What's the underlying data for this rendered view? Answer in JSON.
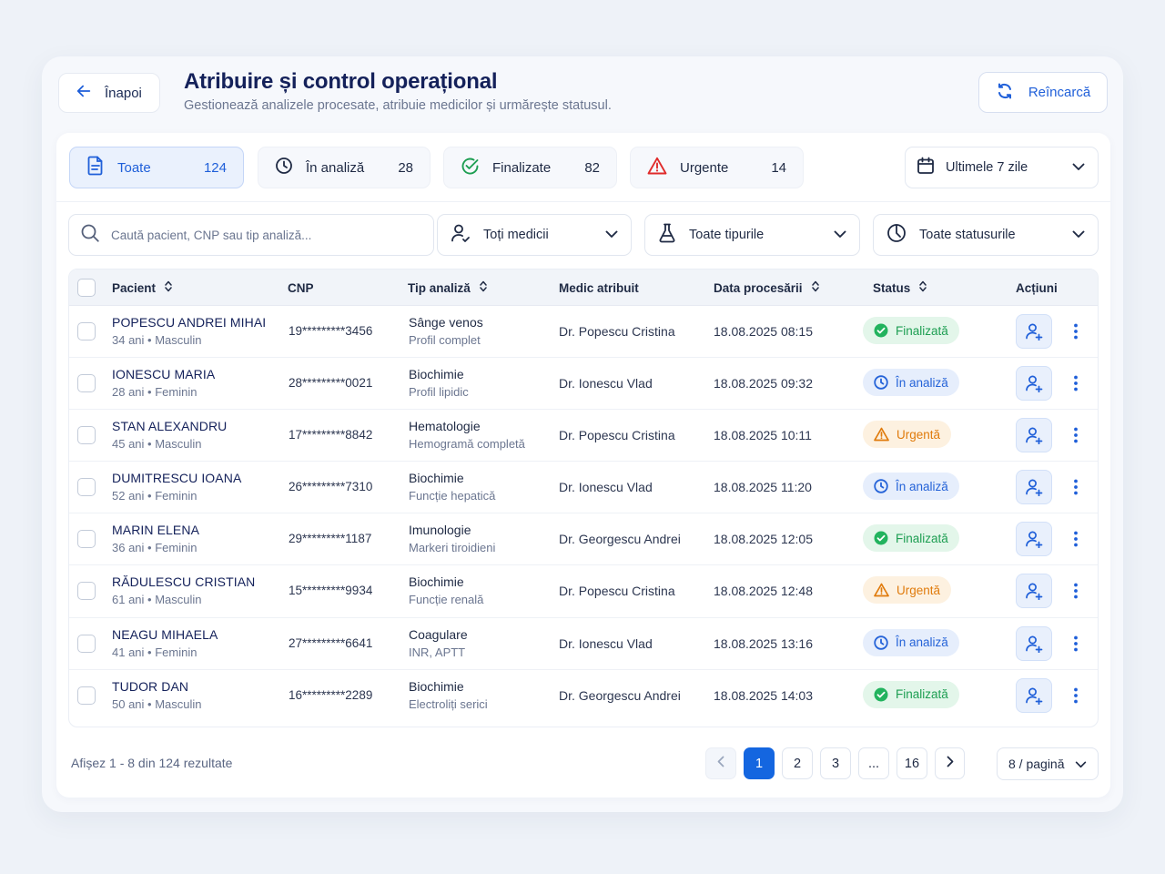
{
  "header": {
    "back_label": "Înapoi",
    "title": "Atribuire și control operațional",
    "subtitle": "Gestionează analizele procesate, atribuie medicilor și urmărește statusul.",
    "reload_label": "Reîncarcă"
  },
  "tabs": [
    {
      "label": "Toate",
      "count": "124",
      "icon": "document-icon",
      "active": true
    },
    {
      "label": "În analiză",
      "count": "28",
      "icon": "clock-icon",
      "active": false
    },
    {
      "label": "Finalizate",
      "count": "82",
      "icon": "check-circle-icon",
      "active": false
    },
    {
      "label": "Urgente",
      "count": "14",
      "icon": "warning-icon",
      "active": false
    }
  ],
  "date_filter": {
    "value": "Ultimele 7 zile",
    "icon": "calendar-icon"
  },
  "search": {
    "placeholder": "Caută pacient, CNP sau tip analiză..."
  },
  "filters": {
    "doctors": "Toți medicii",
    "types": "Toate tipurile",
    "statuses": "Toate statusurile"
  },
  "table": {
    "columns": {
      "patient": "Pacient",
      "cnp": "CNP",
      "type": "Tip analiză",
      "doctor": "Medic atribuit",
      "date": "Data procesării",
      "status": "Status",
      "actions": "Acțiuni"
    },
    "rows": [
      {
        "name": "POPESCU ANDREI MIHAI",
        "info": "34 ani • Masculin",
        "cnp": "19*********3456",
        "type": "Sânge venos",
        "subtype": "Profil complet",
        "doctor": "Dr. Popescu Cristina",
        "date": "18.08.2025 08:15",
        "status": "Finalizată",
        "status_kind": "green"
      },
      {
        "name": "IONESCU MARIA",
        "info": "28 ani • Feminin",
        "cnp": "28*********0021",
        "type": "Biochimie",
        "subtype": "Profil lipidic",
        "doctor": "Dr. Ionescu Vlad",
        "date": "18.08.2025 09:32",
        "status": "În analiză",
        "status_kind": "blue"
      },
      {
        "name": "STAN ALEXANDRU",
        "info": "45 ani • Masculin",
        "cnp": "17*********8842",
        "type": "Hematologie",
        "subtype": "Hemogramă completă",
        "doctor": "Dr. Popescu Cristina",
        "date": "18.08.2025 10:11",
        "status": "Urgentă",
        "status_kind": "orange"
      },
      {
        "name": "DUMITRESCU IOANA",
        "info": "52 ani • Feminin",
        "cnp": "26*********7310",
        "type": "Biochimie",
        "subtype": "Funcție hepatică",
        "doctor": "Dr. Ionescu Vlad",
        "date": "18.08.2025 11:20",
        "status": "În analiză",
        "status_kind": "blue"
      },
      {
        "name": "MARIN ELENA",
        "info": "36 ani • Feminin",
        "cnp": "29*********1187",
        "type": "Imunologie",
        "subtype": "Markeri tiroidieni",
        "doctor": "Dr. Georgescu Andrei",
        "date": "18.08.2025 12:05",
        "status": "Finalizată",
        "status_kind": "green"
      },
      {
        "name": "RĂDULESCU CRISTIAN",
        "info": "61 ani • Masculin",
        "cnp": "15*********9934",
        "type": "Biochimie",
        "subtype": "Funcție renală",
        "doctor": "Dr. Popescu Cristina",
        "date": "18.08.2025 12:48",
        "status": "Urgentă",
        "status_kind": "orange"
      },
      {
        "name": "NEAGU MIHAELA",
        "info": "41 ani • Feminin",
        "cnp": "27*********6641",
        "type": "Coagulare",
        "subtype": "INR, APTT",
        "doctor": "Dr. Ionescu Vlad",
        "date": "18.08.2025 13:16",
        "status": "În analiză",
        "status_kind": "blue"
      },
      {
        "name": "TUDOR DAN",
        "info": "50 ani • Masculin",
        "cnp": "16*********2289",
        "type": "Biochimie",
        "subtype": "Electroliți serici",
        "doctor": "Dr. Georgescu Andrei",
        "date": "18.08.2025 14:03",
        "status": "Finalizată",
        "status_kind": "green"
      }
    ]
  },
  "footer": {
    "summary": "Afișez 1 - 8 din 124 rezultate",
    "pages": [
      "1",
      "2",
      "3",
      "...",
      "16"
    ],
    "current_page": "1",
    "per_page": "8 / pagină"
  },
  "colors": {
    "accent": "#1466e0",
    "title": "#14215a",
    "status_green": "#1d9e52",
    "status_blue": "#2563d8",
    "status_orange": "#e07b0c",
    "warning_red": "#e02b2b"
  }
}
